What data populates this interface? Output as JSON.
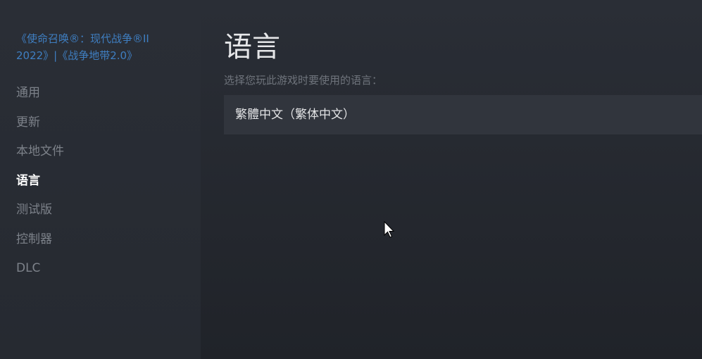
{
  "sidebar": {
    "game_title": "《使命召唤®：现代战争®II 2022》|《战争地带2.0》",
    "items": [
      {
        "label": "通用",
        "active": false
      },
      {
        "label": "更新",
        "active": false
      },
      {
        "label": "本地文件",
        "active": false
      },
      {
        "label": "语言",
        "active": true
      },
      {
        "label": "测试版",
        "active": false
      },
      {
        "label": "控制器",
        "active": false
      },
      {
        "label": "DLC",
        "active": false
      }
    ]
  },
  "main": {
    "title": "语言",
    "prompt": "选择您玩此游戏时要使用的语言：",
    "selected_language": "繁體中文（繁体中文）"
  },
  "colors": {
    "accent": "#3f7fc2",
    "background": "#23262d"
  }
}
